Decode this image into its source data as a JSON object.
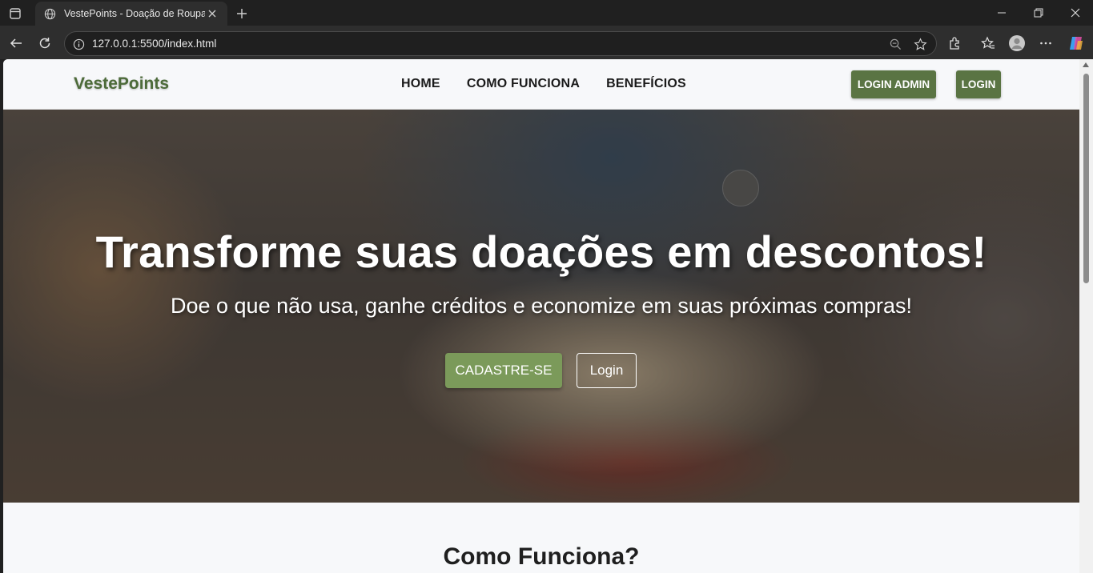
{
  "browser": {
    "tab_title": "VestePoints - Doação de Roupas",
    "url": "127.0.0.1:5500/index.html"
  },
  "header": {
    "brand": "VestePoints",
    "nav": [
      "HOME",
      "COMO FUNCIONA",
      "BENEFÍCIOS"
    ],
    "login_admin": "LOGIN ADMIN",
    "login": "LOGIN"
  },
  "hero": {
    "title": "Transforme suas doações em descontos!",
    "subtitle": "Doe o que não usa, ganhe créditos e economize em suas próximas compras!",
    "signup_button": "CADASTRE-SE",
    "login_button": "Login"
  },
  "section": {
    "title": "Como Funciona?"
  },
  "colors": {
    "brand_green": "#4d6b3a",
    "button_green": "#5a7443",
    "cta_green": "#7b9a5a"
  }
}
